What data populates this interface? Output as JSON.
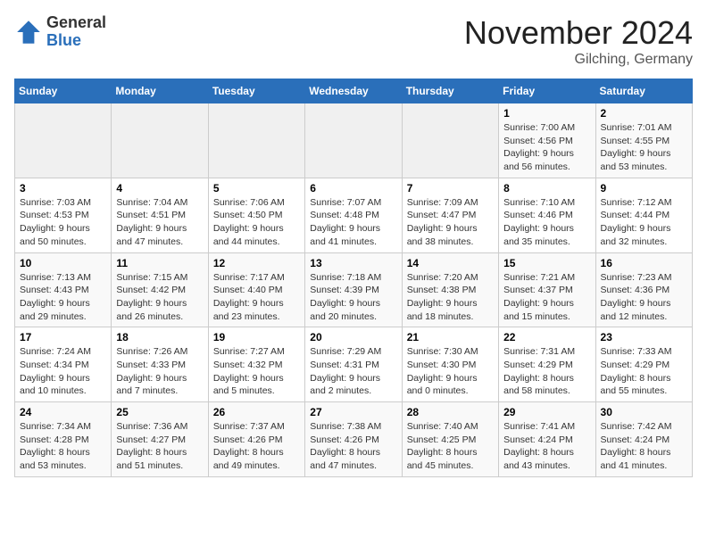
{
  "header": {
    "logo_general": "General",
    "logo_blue": "Blue",
    "month_title": "November 2024",
    "location": "Gilching, Germany"
  },
  "weekdays": [
    "Sunday",
    "Monday",
    "Tuesday",
    "Wednesday",
    "Thursday",
    "Friday",
    "Saturday"
  ],
  "weeks": [
    [
      {
        "day": "",
        "info": ""
      },
      {
        "day": "",
        "info": ""
      },
      {
        "day": "",
        "info": ""
      },
      {
        "day": "",
        "info": ""
      },
      {
        "day": "",
        "info": ""
      },
      {
        "day": "1",
        "info": "Sunrise: 7:00 AM\nSunset: 4:56 PM\nDaylight: 9 hours and 56 minutes."
      },
      {
        "day": "2",
        "info": "Sunrise: 7:01 AM\nSunset: 4:55 PM\nDaylight: 9 hours and 53 minutes."
      }
    ],
    [
      {
        "day": "3",
        "info": "Sunrise: 7:03 AM\nSunset: 4:53 PM\nDaylight: 9 hours and 50 minutes."
      },
      {
        "day": "4",
        "info": "Sunrise: 7:04 AM\nSunset: 4:51 PM\nDaylight: 9 hours and 47 minutes."
      },
      {
        "day": "5",
        "info": "Sunrise: 7:06 AM\nSunset: 4:50 PM\nDaylight: 9 hours and 44 minutes."
      },
      {
        "day": "6",
        "info": "Sunrise: 7:07 AM\nSunset: 4:48 PM\nDaylight: 9 hours and 41 minutes."
      },
      {
        "day": "7",
        "info": "Sunrise: 7:09 AM\nSunset: 4:47 PM\nDaylight: 9 hours and 38 minutes."
      },
      {
        "day": "8",
        "info": "Sunrise: 7:10 AM\nSunset: 4:46 PM\nDaylight: 9 hours and 35 minutes."
      },
      {
        "day": "9",
        "info": "Sunrise: 7:12 AM\nSunset: 4:44 PM\nDaylight: 9 hours and 32 minutes."
      }
    ],
    [
      {
        "day": "10",
        "info": "Sunrise: 7:13 AM\nSunset: 4:43 PM\nDaylight: 9 hours and 29 minutes."
      },
      {
        "day": "11",
        "info": "Sunrise: 7:15 AM\nSunset: 4:42 PM\nDaylight: 9 hours and 26 minutes."
      },
      {
        "day": "12",
        "info": "Sunrise: 7:17 AM\nSunset: 4:40 PM\nDaylight: 9 hours and 23 minutes."
      },
      {
        "day": "13",
        "info": "Sunrise: 7:18 AM\nSunset: 4:39 PM\nDaylight: 9 hours and 20 minutes."
      },
      {
        "day": "14",
        "info": "Sunrise: 7:20 AM\nSunset: 4:38 PM\nDaylight: 9 hours and 18 minutes."
      },
      {
        "day": "15",
        "info": "Sunrise: 7:21 AM\nSunset: 4:37 PM\nDaylight: 9 hours and 15 minutes."
      },
      {
        "day": "16",
        "info": "Sunrise: 7:23 AM\nSunset: 4:36 PM\nDaylight: 9 hours and 12 minutes."
      }
    ],
    [
      {
        "day": "17",
        "info": "Sunrise: 7:24 AM\nSunset: 4:34 PM\nDaylight: 9 hours and 10 minutes."
      },
      {
        "day": "18",
        "info": "Sunrise: 7:26 AM\nSunset: 4:33 PM\nDaylight: 9 hours and 7 minutes."
      },
      {
        "day": "19",
        "info": "Sunrise: 7:27 AM\nSunset: 4:32 PM\nDaylight: 9 hours and 5 minutes."
      },
      {
        "day": "20",
        "info": "Sunrise: 7:29 AM\nSunset: 4:31 PM\nDaylight: 9 hours and 2 minutes."
      },
      {
        "day": "21",
        "info": "Sunrise: 7:30 AM\nSunset: 4:30 PM\nDaylight: 9 hours and 0 minutes."
      },
      {
        "day": "22",
        "info": "Sunrise: 7:31 AM\nSunset: 4:29 PM\nDaylight: 8 hours and 58 minutes."
      },
      {
        "day": "23",
        "info": "Sunrise: 7:33 AM\nSunset: 4:29 PM\nDaylight: 8 hours and 55 minutes."
      }
    ],
    [
      {
        "day": "24",
        "info": "Sunrise: 7:34 AM\nSunset: 4:28 PM\nDaylight: 8 hours and 53 minutes."
      },
      {
        "day": "25",
        "info": "Sunrise: 7:36 AM\nSunset: 4:27 PM\nDaylight: 8 hours and 51 minutes."
      },
      {
        "day": "26",
        "info": "Sunrise: 7:37 AM\nSunset: 4:26 PM\nDaylight: 8 hours and 49 minutes."
      },
      {
        "day": "27",
        "info": "Sunrise: 7:38 AM\nSunset: 4:26 PM\nDaylight: 8 hours and 47 minutes."
      },
      {
        "day": "28",
        "info": "Sunrise: 7:40 AM\nSunset: 4:25 PM\nDaylight: 8 hours and 45 minutes."
      },
      {
        "day": "29",
        "info": "Sunrise: 7:41 AM\nSunset: 4:24 PM\nDaylight: 8 hours and 43 minutes."
      },
      {
        "day": "30",
        "info": "Sunrise: 7:42 AM\nSunset: 4:24 PM\nDaylight: 8 hours and 41 minutes."
      }
    ]
  ]
}
